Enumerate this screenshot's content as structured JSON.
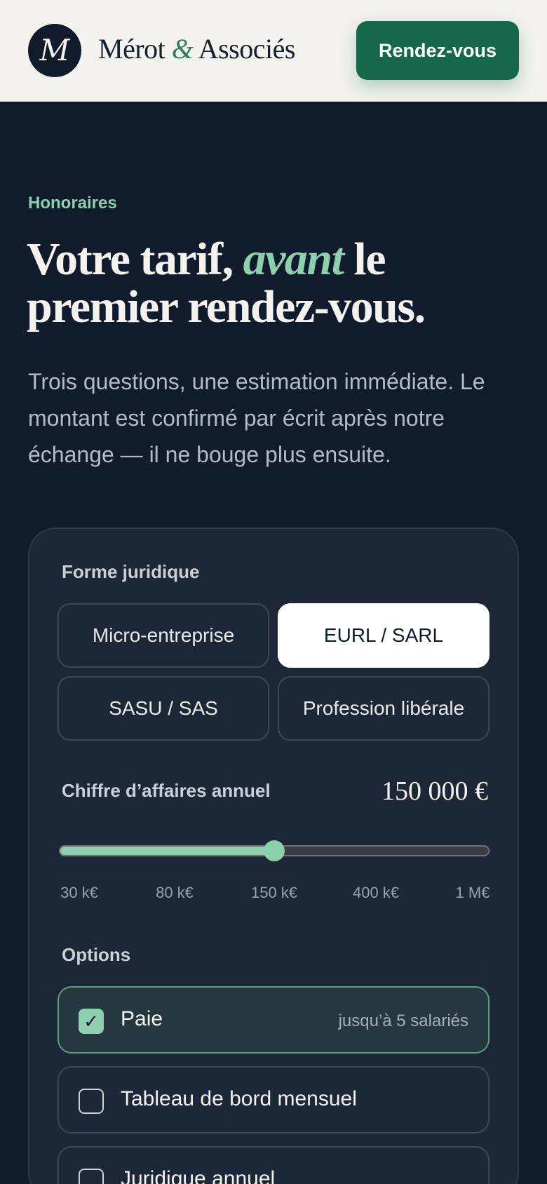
{
  "header": {
    "logo_letter": "M",
    "brand_part1": "Mérot ",
    "brand_amp": "&",
    "brand_part2": " Associés",
    "cta_label": "Rendez-vous"
  },
  "hero": {
    "eyebrow": "Honoraires",
    "title_part1": "Votre tarif, ",
    "title_accent": "avant",
    "title_part2": " le premier rendez-vous.",
    "lead": "Trois questions, une estimation immédiate. Le montant est confirmé par écrit après notre échange — il ne bouge plus ensuite."
  },
  "form": {
    "legal_form_label": "Forme juridique",
    "legal_forms": [
      "Micro-entreprise",
      "EURL / SARL",
      "SASU / SAS",
      "Profession libérale"
    ],
    "selected_legal_form": "EURL / SARL",
    "revenue_label": "Chiffre d’affaires annuel",
    "revenue_value": "150 000 €",
    "slider_ticks": [
      "30 k€",
      "80 k€",
      "150 k€",
      "400 k€",
      "1 M€"
    ],
    "slider_level": 0.5,
    "options_label": "Options",
    "options": [
      {
        "label": "Paie",
        "note": "jusqu’à 5 salariés",
        "checked": true
      },
      {
        "label": "Tableau de bord mensuel",
        "note": "",
        "checked": false
      },
      {
        "label": "Juridique annuel",
        "note": "",
        "checked": false
      }
    ]
  },
  "colors": {
    "background": "#101c2c",
    "header_bg": "#f3f2ee",
    "accent_green": "#8ecfae",
    "cta_green": "#16674c",
    "card_bg": "#1c2838"
  }
}
